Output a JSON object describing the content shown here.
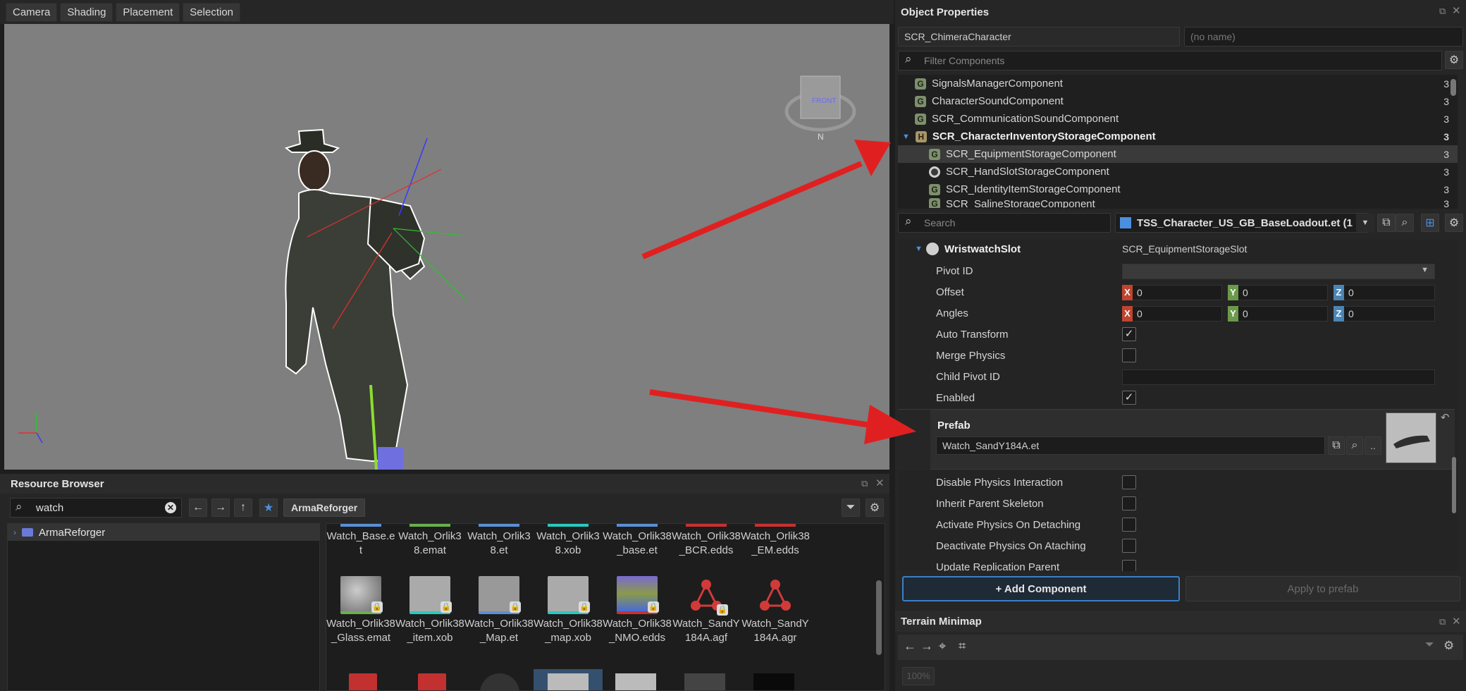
{
  "viewport": {
    "menu": [
      "Camera",
      "Shading",
      "Placement",
      "Selection"
    ]
  },
  "resource_browser": {
    "title": "Resource Browser",
    "search_value": "watch",
    "root_label": "ArmaReforger",
    "tree_root": "ArmaReforger",
    "files_row1": [
      "Watch_Base.et",
      "Watch_Orlik38.emat",
      "Watch_Orlik38.et",
      "Watch_Orlik38.xob",
      "Watch_Orlik38_base.et",
      "Watch_Orlik38_BCR.edds",
      "Watch_Orlik38_EM.edds"
    ],
    "files_row2": [
      "Watch_Orlik38_Glass.emat",
      "Watch_Orlik38_item.xob",
      "Watch_Orlik38_Map.et",
      "Watch_Orlik38_map.xob",
      "Watch_Orlik38_NMO.edds",
      "Watch_SandY184A.agf",
      "Watch_SandY184A.agr"
    ]
  },
  "object_properties": {
    "title": "Object Properties",
    "class_name": "SCR_ChimeraCharacter",
    "name_placeholder": "(no name)",
    "filter_placeholder": "Filter Components",
    "components": [
      {
        "label": "SignalsManagerComponent",
        "count": "3"
      },
      {
        "label": "CharacterSoundComponent",
        "count": "3"
      },
      {
        "label": "SCR_CommunicationSoundComponent",
        "count": "3"
      },
      {
        "label": "SCR_CharacterInventoryStorageComponent",
        "count": "3"
      },
      {
        "label": "SCR_EquipmentStorageComponent",
        "count": "3"
      },
      {
        "label": "SCR_HandSlotStorageComponent",
        "count": "3"
      },
      {
        "label": "SCR_IdentityItemStorageComponent",
        "count": "3"
      },
      {
        "label": "SCR_SalineStorageComponent",
        "count": "3"
      }
    ],
    "search_placeholder": "Search",
    "prefab_file": "TSS_Character_US_GB_BaseLoadout.et (1",
    "slot_name": "WristwatchSlot",
    "slot_type": "SCR_EquipmentStorageSlot",
    "labels": {
      "pivot": "Pivot ID",
      "offset": "Offset",
      "angles": "Angles",
      "auto_transform": "Auto Transform",
      "merge_physics": "Merge Physics",
      "child_pivot": "Child Pivot ID",
      "enabled": "Enabled",
      "prefab": "Prefab",
      "disable_physics": "Disable Physics Interaction",
      "inherit_skeleton": "Inherit Parent Skeleton",
      "activate_physics": "Activate Physics On Detaching",
      "deactivate_physics": "Deactivate Physics On Ataching",
      "update_replication": "Update Replication Parent"
    },
    "axis": {
      "x": "X",
      "y": "Y",
      "z": "Z"
    },
    "offset": [
      "0",
      "0",
      "0"
    ],
    "angles": [
      "0",
      "0",
      "0"
    ],
    "auto_transform": true,
    "merge_physics": false,
    "enabled": true,
    "prefab_value": "Watch_SandY184A.et",
    "ellipsis": "..",
    "add_component": "+ Add Component",
    "apply_to_prefab": "Apply to prefab"
  },
  "terrain": {
    "title": "Terrain Minimap",
    "zoom": "100%"
  },
  "gizmo": {
    "front": "FRONT",
    "north": "N"
  },
  "colors": {
    "accent": "#3b7fc6",
    "arrow": "#e02020",
    "x_axis": "#c0442f",
    "y_axis": "#6a9a4a",
    "z_axis": "#4a85b5"
  }
}
